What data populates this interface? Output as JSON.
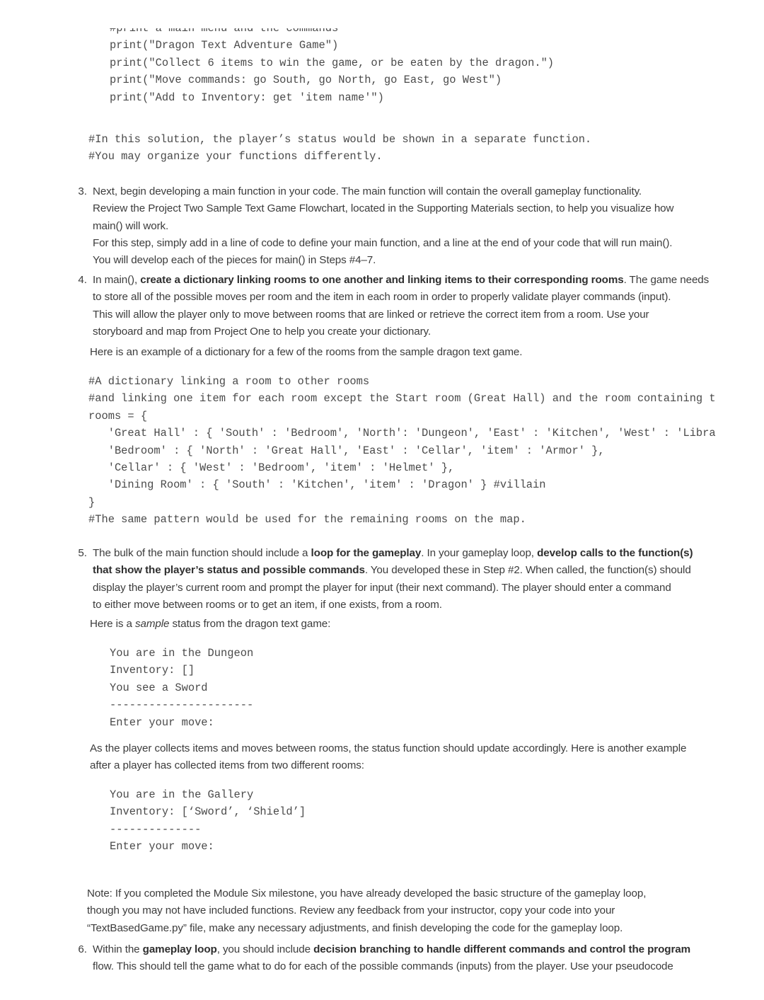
{
  "document": {
    "type": "course-assignment-guidelines",
    "page_background": "#ffffff",
    "text_color": "#3c3c3c"
  },
  "code_block_top": {
    "name": "main-menu-print-code",
    "lines": [
      "#print a main menu and the commands",
      "print(\"Dragon Text Adventure Game\")",
      "print(\"Collect 6 items to win the game, or be eaten by the dragon.\")",
      "print(\"Move commands: go South, go North, go East, go West\")",
      "print(\"Add to Inventory: get 'item name'\")"
    ],
    "comment_lines": [
      "#In this solution, the player’s status would be shown in a separate function.",
      "#You may organize your functions differently."
    ]
  },
  "item3": {
    "number": "3.",
    "line1": "Next, begin developing a main function in your code. The main function will contain the overall gameplay functionality.",
    "line2": "Review the Project Two Sample Text Game Flowchart, located in the Supporting Materials section, to help you visualize how",
    "line3": "main() will work.",
    "line4": "For this step, simply add in a line of code to define your main function, and a line at the end of your code that will run main().",
    "line5": "You will develop each of the pieces for main() in Steps #4–7."
  },
  "item4": {
    "number": "4.",
    "lead_plain": "In main(), ",
    "lead_bold": "create a dictionary linking rooms to one another and linking items to their corresponding rooms",
    "lead_rest": ". The game needs",
    "line2": "to store all of the possible moves per room and the item in each room in order to properly validate player commands (input).",
    "line3": "This will allow the player only to move between rooms that are linked or retrieve the correct item from a room. Use your",
    "line4": "storyboard and map from Project One to help you create your dictionary.",
    "example_intro": "Here is an example of a dictionary for a few of the rooms from the sample dragon text game."
  },
  "code_block_dict": {
    "name": "rooms-dictionary-code",
    "lines": [
      "#A dictionary linking a room to other rooms",
      "#and linking one item for each room except the Start room (Great Hall) and the room containing the villain",
      "rooms = {",
      "   'Great Hall' : { 'South' : 'Bedroom', 'North': 'Dungeon', 'East' : 'Kitchen', 'West' : 'Library' },",
      "   'Bedroom' : { 'North' : 'Great Hall', 'East' : 'Cellar', 'item' : 'Armor' },",
      "   'Cellar' : { 'West' : 'Bedroom', 'item' : 'Helmet' },",
      "   'Dining Room' : { 'South' : 'Kitchen', 'item' : 'Dragon' } #villain",
      "}",
      "#The same pattern would be used for the remaining rooms on the map."
    ]
  },
  "item5": {
    "number": "5.",
    "l1a": "The bulk of the main function should include a ",
    "l1b": "loop for the gameplay",
    "l1c": ". In your gameplay loop, ",
    "l1d": "develop calls to the function(s)",
    "l2a": "that show the player’s status and possible commands",
    "l2b": ". You developed these in Step #2. When called, the function(s) should",
    "line3": "display the player’s current room and prompt the player for input (their next command). The player should enter a command",
    "line4": "to either move between rooms or to get an item, if one exists, from a room.",
    "sample_intro_a": "Here is a ",
    "sample_intro_italic": "sample",
    "sample_intro_b": " status from the dragon text game:"
  },
  "status_block_1": {
    "name": "dungeon-status-output",
    "lines": [
      "You are in the Dungeon",
      "Inventory: []",
      "You see a Sword",
      "----------------------",
      "Enter your move:"
    ]
  },
  "between_status": {
    "line1": "As the player collects items and moves between rooms, the status function should update accordingly. Here is another example",
    "line2": "after a player has collected items from two different rooms:"
  },
  "status_block_2": {
    "name": "gallery-status-output",
    "lines": [
      "You are in the Gallery",
      "Inventory: [‘Sword’, ‘Shield’]",
      "--------------",
      "Enter your move:"
    ]
  },
  "note": {
    "line1": "Note: If you completed the Module Six milestone, you have already developed the basic structure of the gameplay loop,",
    "line2": "though you may not have included functions. Review any feedback from your instructor, copy your code into your",
    "line3": "“TextBasedGame.py” file, make any necessary adjustments, and finish developing the code for the gameplay loop."
  },
  "item6": {
    "number": "6.",
    "l1a": "Within the ",
    "l1b": "gameplay loop",
    "l1c": ", you should include ",
    "l1d": "decision branching to handle different commands and control the program",
    "line2": "flow. This should tell the game what to do for each of the possible commands (inputs) from the player. Use your pseudocode"
  }
}
